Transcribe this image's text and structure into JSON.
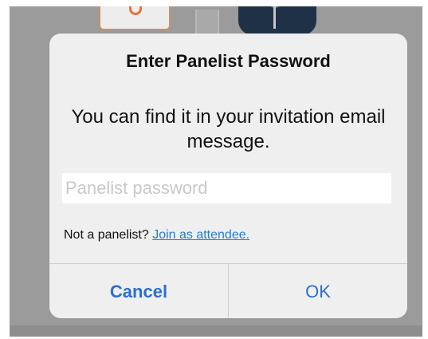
{
  "dialog": {
    "title": "Enter Panelist Password",
    "message": "You can find it in your invitation email message.",
    "password_input": {
      "value": "",
      "placeholder": "Panelist password"
    },
    "attendee_prompt": "Not a panelist?",
    "attendee_link": "Join as attendee.",
    "cancel_label": "Cancel",
    "ok_label": "OK"
  },
  "colors": {
    "accent": "#2a6fd0",
    "link": "#2a7bd6",
    "dialog_background": "#efefef",
    "backdrop": "#9b9b9b"
  }
}
